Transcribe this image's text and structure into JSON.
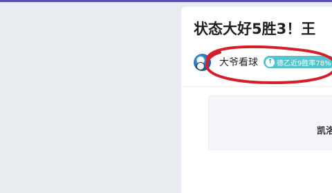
{
  "article": {
    "title": "状态大好5胜3！王",
    "author": {
      "name": "大爷看球",
      "badge": "德乙近9胜率78%",
      "badge_icon": "arrow-up-icon"
    },
    "card_text": "凯洛"
  },
  "colors": {
    "page_background": "#e8ebf0",
    "top_bar": "#5a4ea8",
    "badge": "#55c4cf",
    "annotation_circle": "#d21f2a"
  }
}
